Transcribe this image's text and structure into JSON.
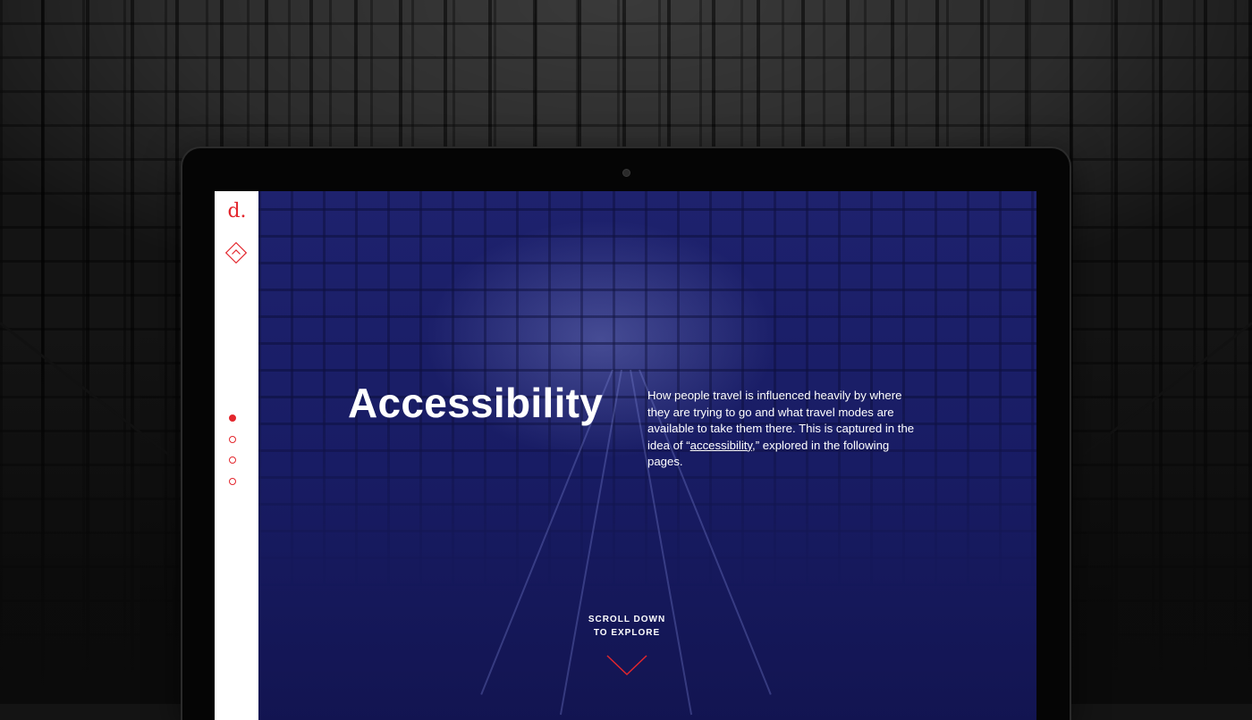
{
  "brand": {
    "logo_text": "d.",
    "accent_color": "#e3262d"
  },
  "icons": {
    "home": "diamond-chevron-up-icon",
    "scroll": "chevron-down-icon"
  },
  "sidebar": {
    "nav_dots": [
      {
        "active": true
      },
      {
        "active": false
      },
      {
        "active": false
      },
      {
        "active": false
      }
    ]
  },
  "hero": {
    "title": "Accessibility",
    "description_before": "How people travel is influenced heavily by where they are trying to go and what travel modes are available to take them there. This is captured in the idea of “",
    "description_link": "accessibility",
    "description_after": ",” explored in the following pages.",
    "scroll_line1": "SCROLL DOWN",
    "scroll_line2": "TO EXPLORE"
  }
}
